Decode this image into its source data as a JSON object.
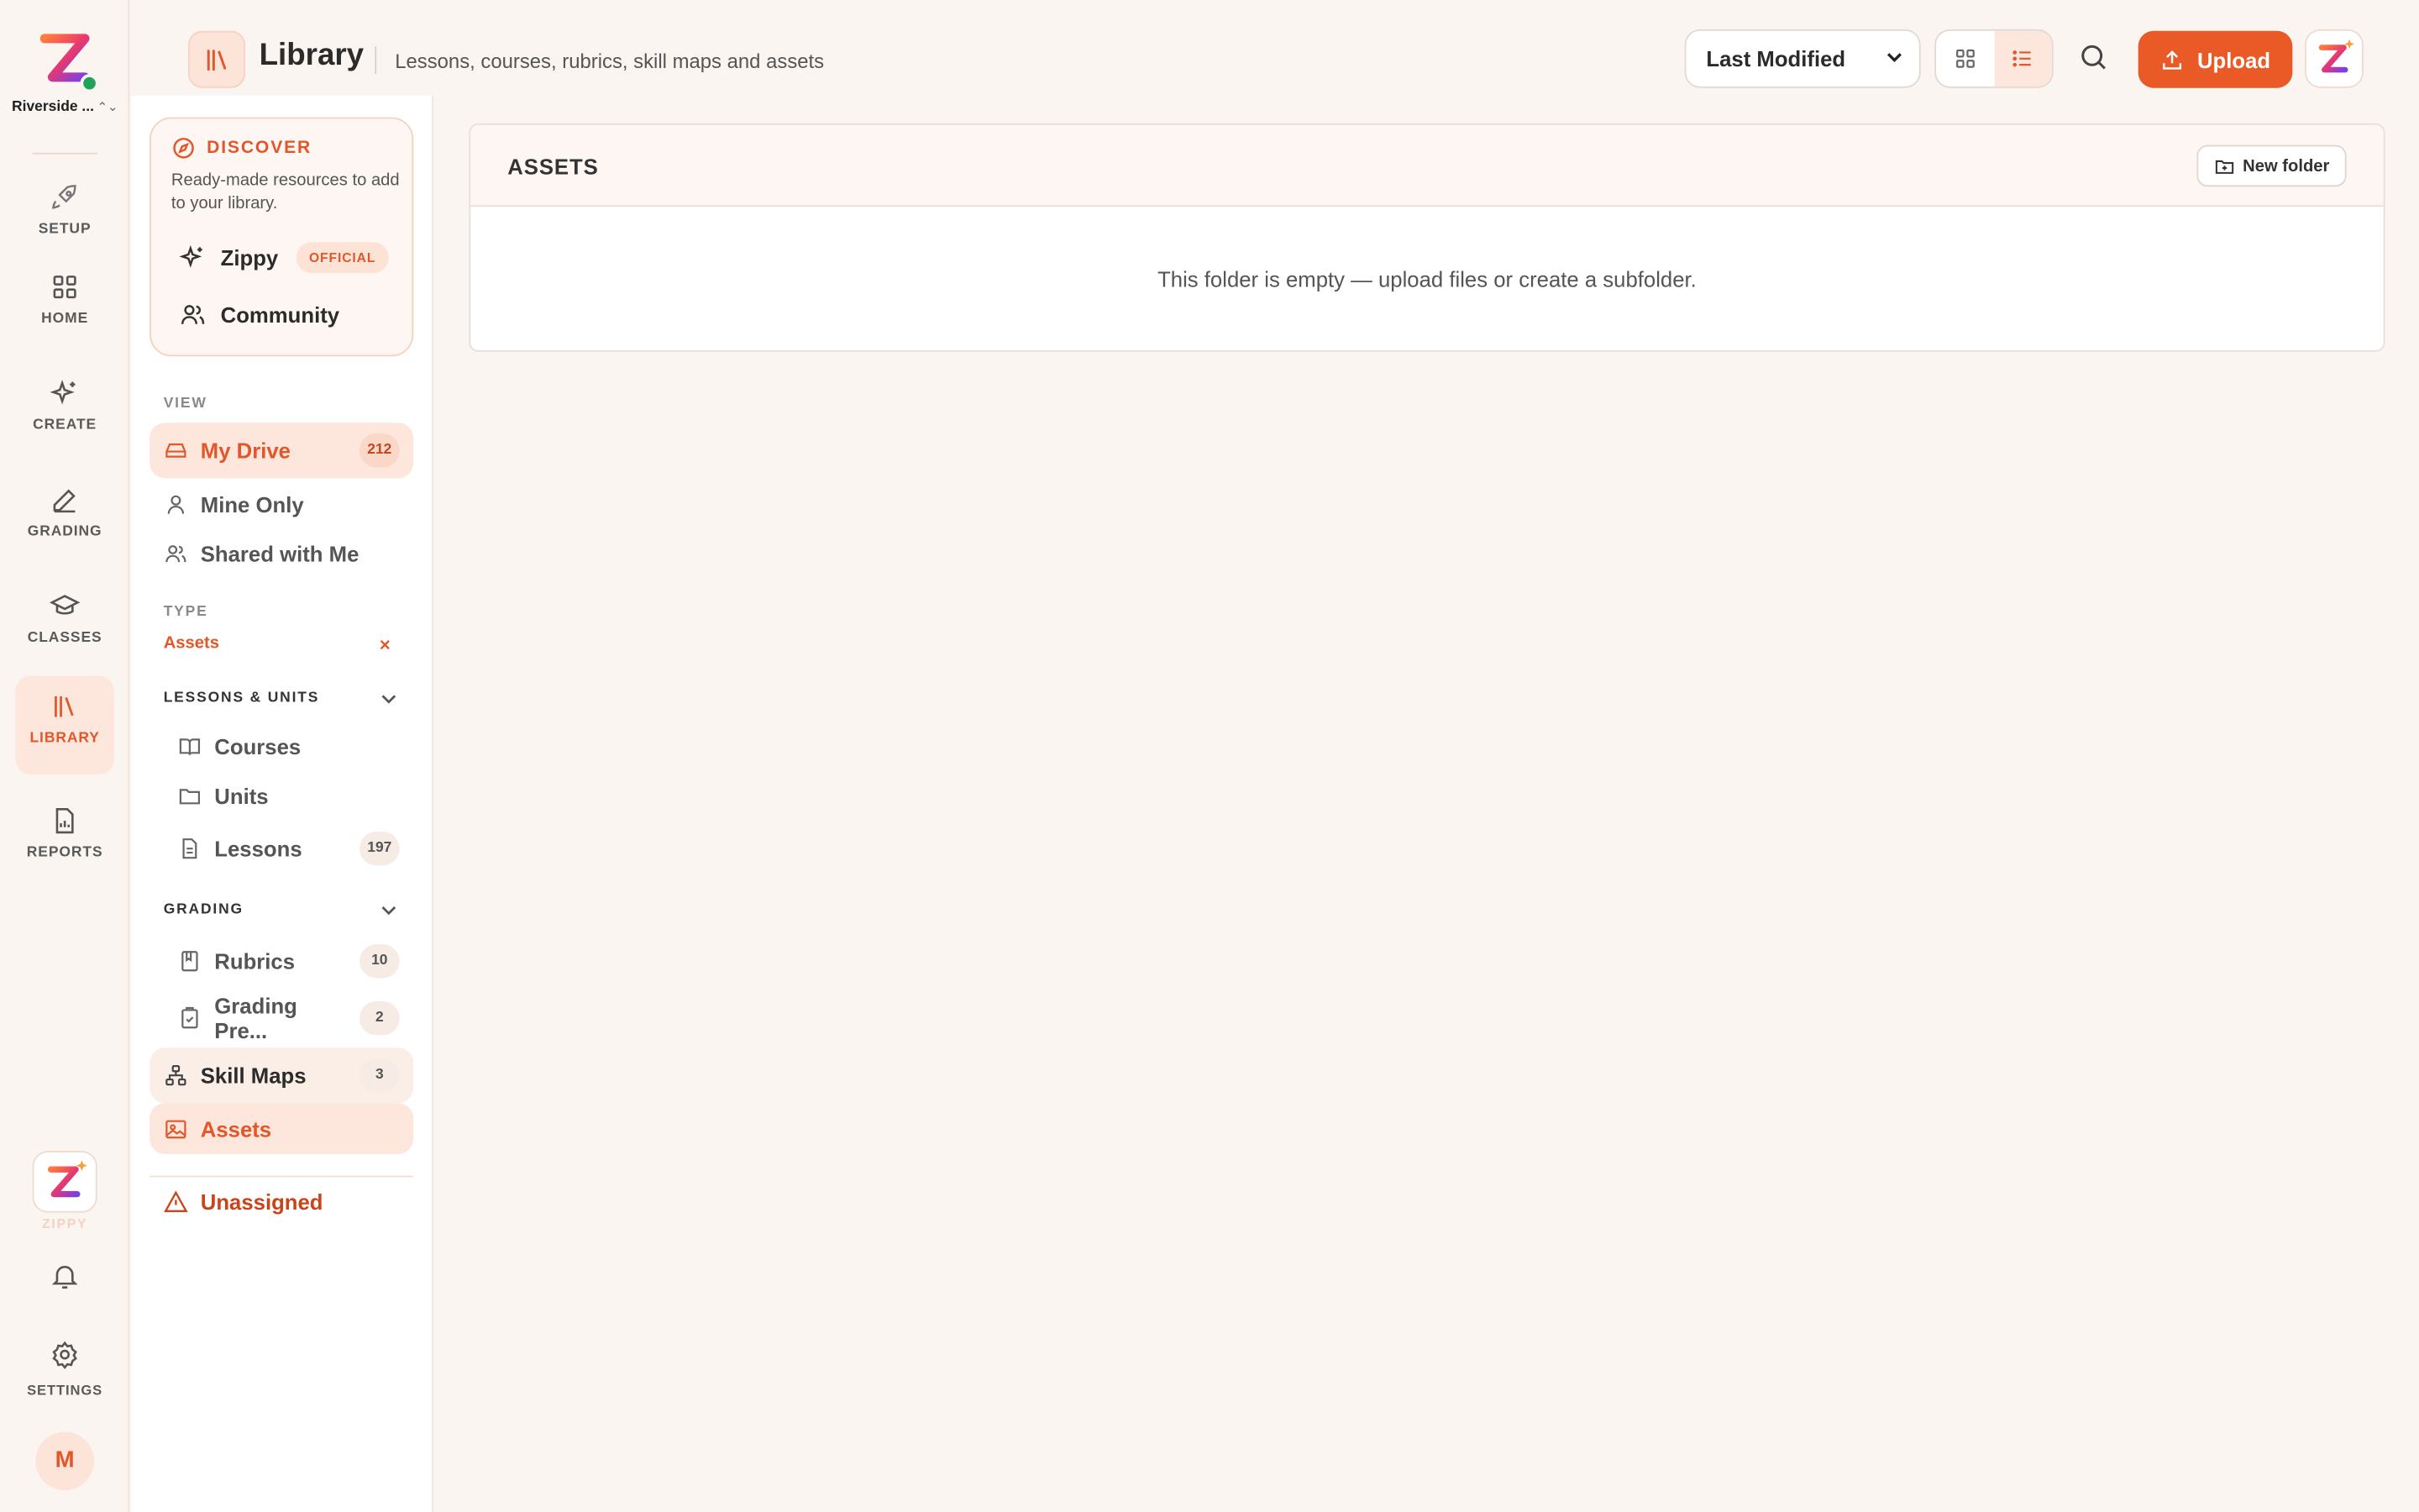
{
  "org": {
    "name": "Riverside ...",
    "chevron": "⌃⌄"
  },
  "rail": [
    {
      "id": "setup",
      "label": "SETUP",
      "icon": "rocket-icon"
    },
    {
      "id": "home",
      "label": "HOME",
      "icon": "grid-icon"
    },
    {
      "id": "create",
      "label": "CREATE",
      "icon": "sparkles-icon"
    },
    {
      "id": "grading",
      "label": "GRADING",
      "icon": "pen-icon"
    },
    {
      "id": "classes",
      "label": "CLASSES",
      "icon": "graduation-cap-icon"
    },
    {
      "id": "library",
      "label": "LIBRARY",
      "icon": "library-icon",
      "active": true
    },
    {
      "id": "reports",
      "label": "REPORTS",
      "icon": "report-icon"
    }
  ],
  "rail_bottom": {
    "zippy_label": "ZIPPY",
    "settings_label": "SETTINGS",
    "avatar_initial": "M"
  },
  "header": {
    "title": "Library",
    "subtitle": "Lessons, courses, rubrics, skill maps and assets",
    "sort_value": "Last Modified",
    "upload_label": "Upload"
  },
  "discover": {
    "title": "DISCOVER",
    "description": "Ready-made resources to add to your library.",
    "items": [
      {
        "label": "Zippy",
        "badge": "OFFICIAL",
        "icon": "sparkles-icon"
      },
      {
        "label": "Community",
        "icon": "users-icon"
      }
    ]
  },
  "sidebar": {
    "view_label": "VIEW",
    "my_drive": {
      "label": "My Drive",
      "count": "212"
    },
    "mine_only": "Mine Only",
    "shared_with_me": "Shared with Me",
    "type_label": "TYPE",
    "type_value": "Assets",
    "type_clear": "×",
    "lessons_units_label": "LESSONS & UNITS",
    "courses": "Courses",
    "units": "Units",
    "lessons": {
      "label": "Lessons",
      "count": "197"
    },
    "grading_label": "GRADING",
    "rubrics": {
      "label": "Rubrics",
      "count": "10"
    },
    "grading_presets": {
      "label": "Grading Pre...",
      "count": "2"
    },
    "skill_maps": {
      "label": "Skill Maps",
      "count": "3"
    },
    "assets": "Assets",
    "unassigned": "Unassigned"
  },
  "panel": {
    "title": "ASSETS",
    "new_folder_label": "New folder",
    "empty_message": "This folder is empty — upload files or create a subfolder."
  },
  "colors": {
    "accent": "#ea5a27",
    "accent_soft": "#fde6dc",
    "background": "#fbf5f1",
    "online": "#1fa35c"
  }
}
